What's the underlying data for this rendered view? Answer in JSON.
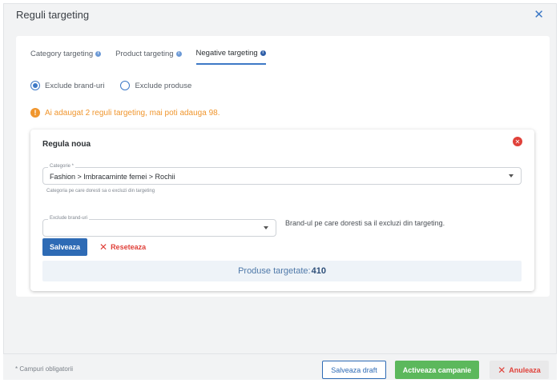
{
  "modal": {
    "title": "Reguli targeting",
    "close_glyph": "✕"
  },
  "tabs": [
    {
      "label": "Category targeting",
      "active": false
    },
    {
      "label": "Product targeting",
      "active": false
    },
    {
      "label": "Negative targeting",
      "active": true
    }
  ],
  "radios": [
    {
      "label": "Exclude brand-uri",
      "checked": true
    },
    {
      "label": "Exclude produse",
      "checked": false
    }
  ],
  "warning": {
    "icon": "!",
    "text": "Ai adaugat 2 reguli targeting, mai poti adauga 98."
  },
  "rule": {
    "title": "Regula noua",
    "category_field": {
      "label": "Categorie *",
      "value": "Fashion > Imbracaminte femei > Rochii",
      "helper": "Categoria pe care doresti sa o excluzi din targeting"
    },
    "brand_field": {
      "label": "Exclude brand-uri",
      "value": "",
      "helper": "Brand-ul pe care doresti sa il excluzi din targeting."
    },
    "save_label": "Salveaza",
    "reset_label": "Reseteaza",
    "products_label": "Produse targetate:",
    "products_count": "410"
  },
  "footer": {
    "note": "* Campuri obligatorii",
    "draft_label": "Salveaza draft",
    "activate_label": "Activeaza campanie",
    "cancel_label": "Anuleaza"
  },
  "colors": {
    "primary": "#2e6bb5",
    "success": "#5cb85c",
    "danger": "#e0413a",
    "warning": "#f0962e"
  }
}
